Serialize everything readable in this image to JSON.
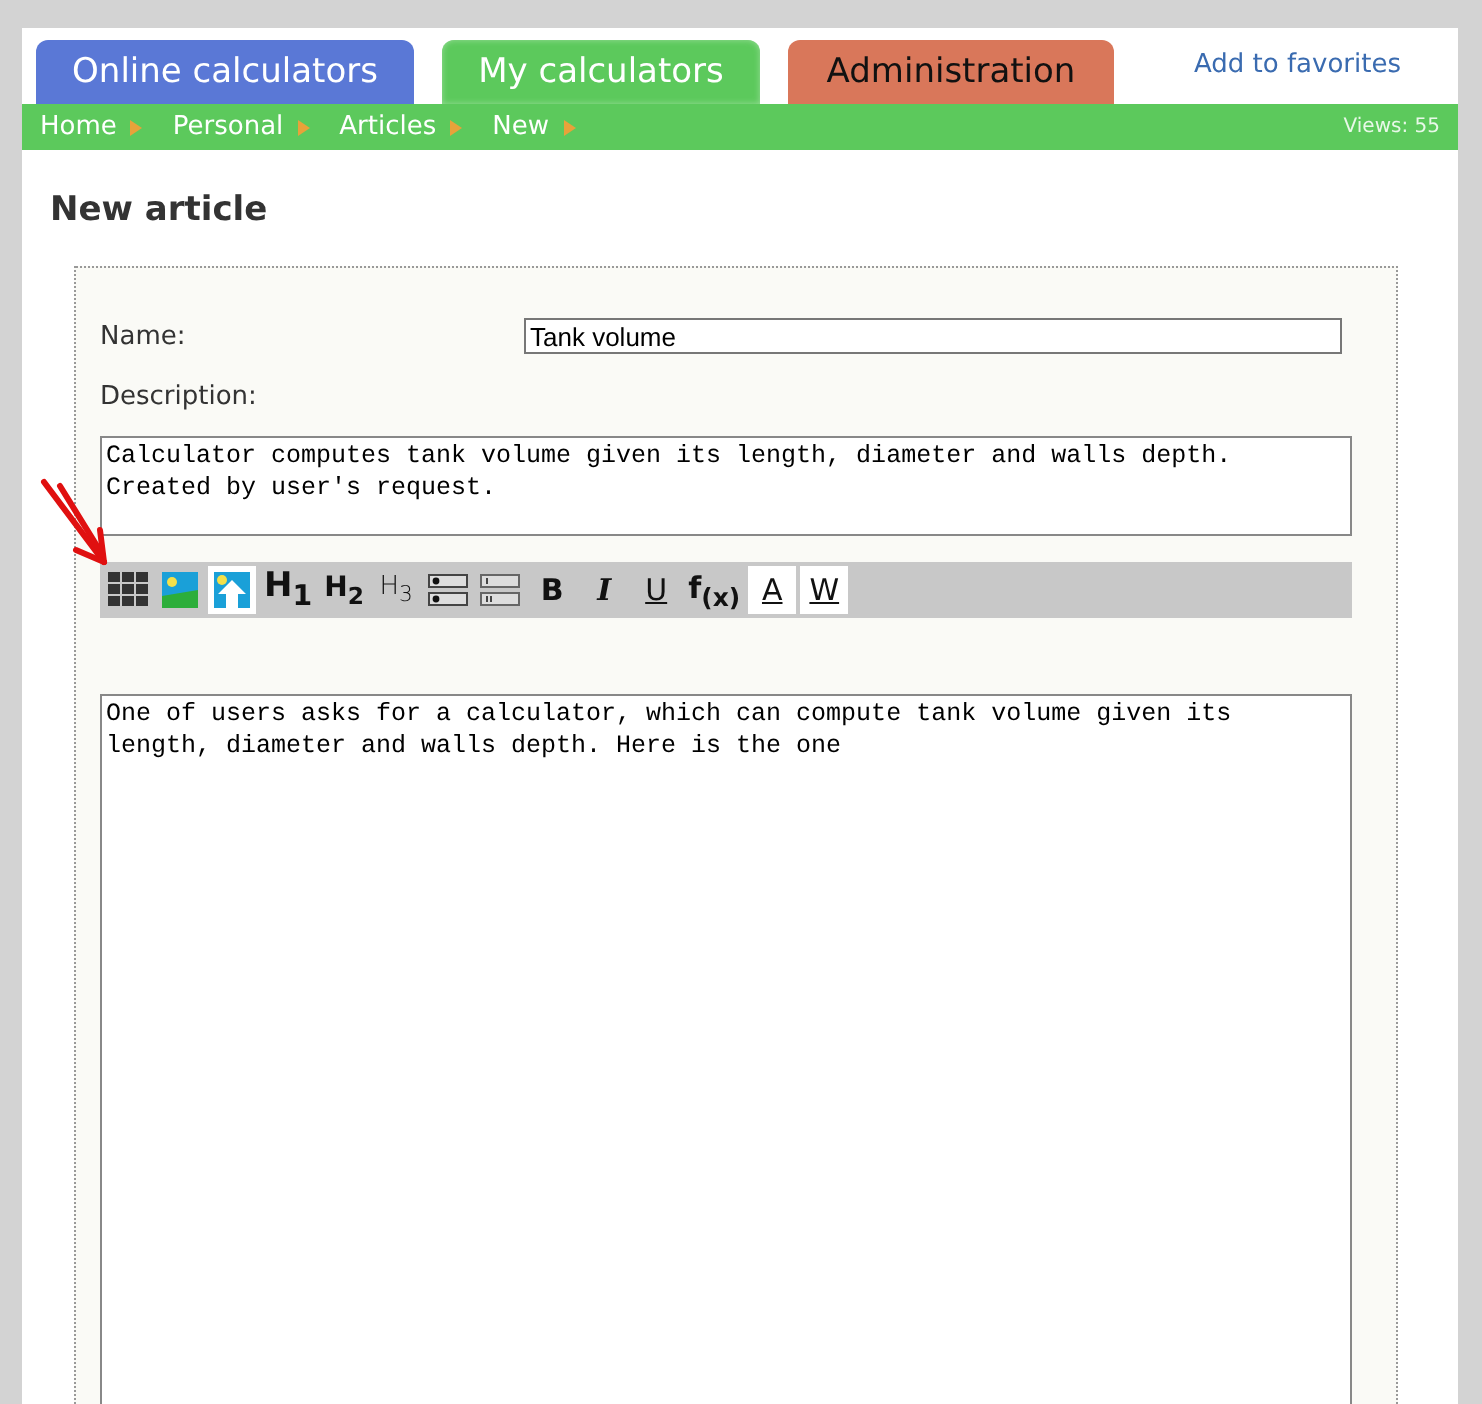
{
  "tabs": [
    {
      "label": "Online calculators",
      "color": "#5a78d6",
      "selected": false
    },
    {
      "label": "My calculators",
      "color": "#5cc95c",
      "selected": true
    },
    {
      "label": "Administration",
      "color": "#d9775a",
      "selected": false
    }
  ],
  "favorites_link": "Add to favorites",
  "breadcrumbs": [
    "Home",
    "Personal",
    "Articles",
    "New"
  ],
  "views": "Views: 55",
  "heading": "New article",
  "form": {
    "name_label": "Name:",
    "name_value": "Tank volume",
    "description_label": "Description:",
    "description_value": "Calculator computes tank volume given its length, diameter and walls depth.\nCreated by user's request.",
    "toolbar": [
      {
        "kind": "grid",
        "highlighted": false
      },
      {
        "kind": "image",
        "highlighted": false
      },
      {
        "kind": "image-upload",
        "highlighted": true
      },
      {
        "kind": "h1",
        "label": "H$_{1}$",
        "highlighted": false
      },
      {
        "kind": "h2",
        "label": "H$_{2}$",
        "highlighted": false
      },
      {
        "kind": "h3",
        "label": "H$_{3}$",
        "highlighted": false
      },
      {
        "kind": "list-bullets",
        "highlighted": false
      },
      {
        "kind": "list-numbers",
        "highlighted": false
      },
      {
        "kind": "bold",
        "label": "B",
        "highlighted": false
      },
      {
        "kind": "italic",
        "label": "I",
        "highlighted": false
      },
      {
        "kind": "underline",
        "label": "U",
        "highlighted": false
      },
      {
        "kind": "formula",
        "label": "f$_{(x)}$",
        "highlighted": false
      },
      {
        "kind": "text-color",
        "label": "A",
        "highlighted": true
      },
      {
        "kind": "text-color",
        "label": "W",
        "highlighted": true
      }
    ],
    "content_value": "One of users asks for a calculator, which can compute tank volume given its\nlength, diameter and walls depth. Here is the one"
  }
}
